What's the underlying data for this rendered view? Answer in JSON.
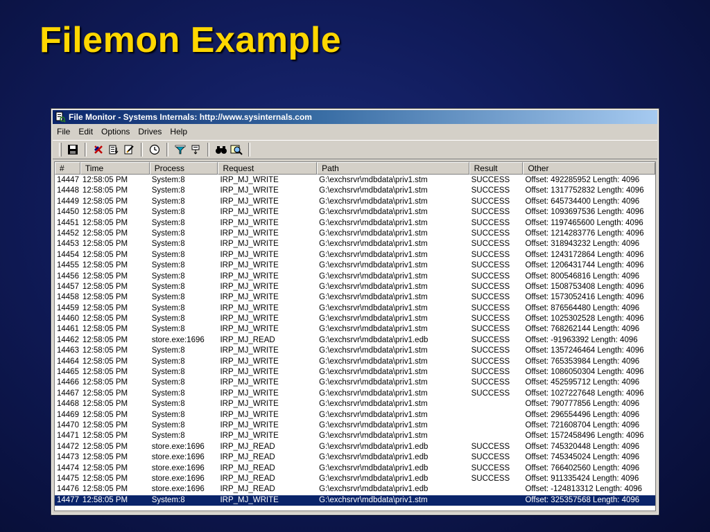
{
  "slide": {
    "title": "Filemon Example"
  },
  "window": {
    "title": "File Monitor - Systems Internals: http://www.sysinternals.com",
    "menu": [
      "File",
      "Edit",
      "Options",
      "Drives",
      "Help"
    ],
    "toolbar": [
      {
        "name": "save-icon"
      },
      {
        "name": "capture-icon"
      },
      {
        "name": "autoscroll-icon"
      },
      {
        "name": "clear-icon"
      },
      {
        "name": "time-icon"
      },
      {
        "name": "filter-icon"
      },
      {
        "name": "highlight-icon"
      },
      {
        "name": "find-icon"
      },
      {
        "name": "explore-icon"
      }
    ],
    "colors": {
      "titlebar": "#0a246a",
      "selection": "#0a246a",
      "face": "#d4d0c8"
    }
  },
  "table": {
    "columns": [
      "#",
      "Time",
      "Process",
      "Request",
      "Path",
      "Result",
      "Other"
    ],
    "selected_row": 30,
    "rows": [
      [
        "14447",
        "12:58:05 PM",
        "System:8",
        "IRP_MJ_WRITE",
        "G:\\exchsrvr\\mdbdata\\priv1.stm",
        "SUCCESS",
        "Offset: 492285952 Length: 4096"
      ],
      [
        "14448",
        "12:58:05 PM",
        "System:8",
        "IRP_MJ_WRITE",
        "G:\\exchsrvr\\mdbdata\\priv1.stm",
        "SUCCESS",
        "Offset: 1317752832 Length: 4096"
      ],
      [
        "14449",
        "12:58:05 PM",
        "System:8",
        "IRP_MJ_WRITE",
        "G:\\exchsrvr\\mdbdata\\priv1.stm",
        "SUCCESS",
        "Offset: 645734400 Length: 4096"
      ],
      [
        "14450",
        "12:58:05 PM",
        "System:8",
        "IRP_MJ_WRITE",
        "G:\\exchsrvr\\mdbdata\\priv1.stm",
        "SUCCESS",
        "Offset: 1093697536 Length: 4096"
      ],
      [
        "14451",
        "12:58:05 PM",
        "System:8",
        "IRP_MJ_WRITE",
        "G:\\exchsrvr\\mdbdata\\priv1.stm",
        "SUCCESS",
        "Offset: 1197465600 Length: 4096"
      ],
      [
        "14452",
        "12:58:05 PM",
        "System:8",
        "IRP_MJ_WRITE",
        "G:\\exchsrvr\\mdbdata\\priv1.stm",
        "SUCCESS",
        "Offset: 1214283776 Length: 4096"
      ],
      [
        "14453",
        "12:58:05 PM",
        "System:8",
        "IRP_MJ_WRITE",
        "G:\\exchsrvr\\mdbdata\\priv1.stm",
        "SUCCESS",
        "Offset: 318943232 Length: 4096"
      ],
      [
        "14454",
        "12:58:05 PM",
        "System:8",
        "IRP_MJ_WRITE",
        "G:\\exchsrvr\\mdbdata\\priv1.stm",
        "SUCCESS",
        "Offset: 1243172864 Length: 4096"
      ],
      [
        "14455",
        "12:58:05 PM",
        "System:8",
        "IRP_MJ_WRITE",
        "G:\\exchsrvr\\mdbdata\\priv1.stm",
        "SUCCESS",
        "Offset: 1206431744 Length: 4096"
      ],
      [
        "14456",
        "12:58:05 PM",
        "System:8",
        "IRP_MJ_WRITE",
        "G:\\exchsrvr\\mdbdata\\priv1.stm",
        "SUCCESS",
        "Offset: 800546816 Length: 4096"
      ],
      [
        "14457",
        "12:58:05 PM",
        "System:8",
        "IRP_MJ_WRITE",
        "G:\\exchsrvr\\mdbdata\\priv1.stm",
        "SUCCESS",
        "Offset: 1508753408 Length: 4096"
      ],
      [
        "14458",
        "12:58:05 PM",
        "System:8",
        "IRP_MJ_WRITE",
        "G:\\exchsrvr\\mdbdata\\priv1.stm",
        "SUCCESS",
        "Offset: 1573052416 Length: 4096"
      ],
      [
        "14459",
        "12:58:05 PM",
        "System:8",
        "IRP_MJ_WRITE",
        "G:\\exchsrvr\\mdbdata\\priv1.stm",
        "SUCCESS",
        "Offset: 876564480 Length: 4096"
      ],
      [
        "14460",
        "12:58:05 PM",
        "System:8",
        "IRP_MJ_WRITE",
        "G:\\exchsrvr\\mdbdata\\priv1.stm",
        "SUCCESS",
        "Offset: 1025302528 Length: 4096"
      ],
      [
        "14461",
        "12:58:05 PM",
        "System:8",
        "IRP_MJ_WRITE",
        "G:\\exchsrvr\\mdbdata\\priv1.stm",
        "SUCCESS",
        "Offset: 768262144 Length: 4096"
      ],
      [
        "14462",
        "12:58:05 PM",
        "store.exe:1696",
        "IRP_MJ_READ",
        "G:\\exchsrvr\\mdbdata\\priv1.edb",
        "SUCCESS",
        "Offset: -91963392 Length: 4096"
      ],
      [
        "14463",
        "12:58:05 PM",
        "System:8",
        "IRP_MJ_WRITE",
        "G:\\exchsrvr\\mdbdata\\priv1.stm",
        "SUCCESS",
        "Offset: 1357246464 Length: 4096"
      ],
      [
        "14464",
        "12:58:05 PM",
        "System:8",
        "IRP_MJ_WRITE",
        "G:\\exchsrvr\\mdbdata\\priv1.stm",
        "SUCCESS",
        "Offset: 765353984 Length: 4096"
      ],
      [
        "14465",
        "12:58:05 PM",
        "System:8",
        "IRP_MJ_WRITE",
        "G:\\exchsrvr\\mdbdata\\priv1.stm",
        "SUCCESS",
        "Offset: 1086050304 Length: 4096"
      ],
      [
        "14466",
        "12:58:05 PM",
        "System:8",
        "IRP_MJ_WRITE",
        "G:\\exchsrvr\\mdbdata\\priv1.stm",
        "SUCCESS",
        "Offset: 452595712 Length: 4096"
      ],
      [
        "14467",
        "12:58:05 PM",
        "System:8",
        "IRP_MJ_WRITE",
        "G:\\exchsrvr\\mdbdata\\priv1.stm",
        "SUCCESS",
        "Offset: 1027227648 Length: 4096"
      ],
      [
        "14468",
        "12:58:05 PM",
        "System:8",
        "IRP_MJ_WRITE",
        "G:\\exchsrvr\\mdbdata\\priv1.stm",
        "",
        "Offset: 790777856 Length: 4096"
      ],
      [
        "14469",
        "12:58:05 PM",
        "System:8",
        "IRP_MJ_WRITE",
        "G:\\exchsrvr\\mdbdata\\priv1.stm",
        "",
        "Offset: 296554496 Length: 4096"
      ],
      [
        "14470",
        "12:58:05 PM",
        "System:8",
        "IRP_MJ_WRITE",
        "G:\\exchsrvr\\mdbdata\\priv1.stm",
        "",
        "Offset: 721608704 Length: 4096"
      ],
      [
        "14471",
        "12:58:05 PM",
        "System:8",
        "IRP_MJ_WRITE",
        "G:\\exchsrvr\\mdbdata\\priv1.stm",
        "",
        "Offset: 1572458496 Length: 4096"
      ],
      [
        "14472",
        "12:58:05 PM",
        "store.exe:1696",
        "IRP_MJ_READ",
        "G:\\exchsrvr\\mdbdata\\priv1.edb",
        "SUCCESS",
        "Offset: 745320448 Length: 4096"
      ],
      [
        "14473",
        "12:58:05 PM",
        "store.exe:1696",
        "IRP_MJ_READ",
        "G:\\exchsrvr\\mdbdata\\priv1.edb",
        "SUCCESS",
        "Offset: 745345024 Length: 4096"
      ],
      [
        "14474",
        "12:58:05 PM",
        "store.exe:1696",
        "IRP_MJ_READ",
        "G:\\exchsrvr\\mdbdata\\priv1.edb",
        "SUCCESS",
        "Offset: 766402560 Length: 4096"
      ],
      [
        "14475",
        "12:58:05 PM",
        "store.exe:1696",
        "IRP_MJ_READ",
        "G:\\exchsrvr\\mdbdata\\priv1.edb",
        "SUCCESS",
        "Offset: 911335424 Length: 4096"
      ],
      [
        "14476",
        "12:58:05 PM",
        "store.exe:1696",
        "IRP_MJ_READ",
        "G:\\exchsrvr\\mdbdata\\priv1.edb",
        "",
        "Offset: -124813312 Length: 4096"
      ],
      [
        "14477",
        "12:58:05 PM",
        "System:8",
        "IRP_MJ_WRITE",
        "G:\\exchsrvr\\mdbdata\\priv1.stm",
        "",
        "Offset: 325357568 Length: 4096"
      ]
    ]
  }
}
